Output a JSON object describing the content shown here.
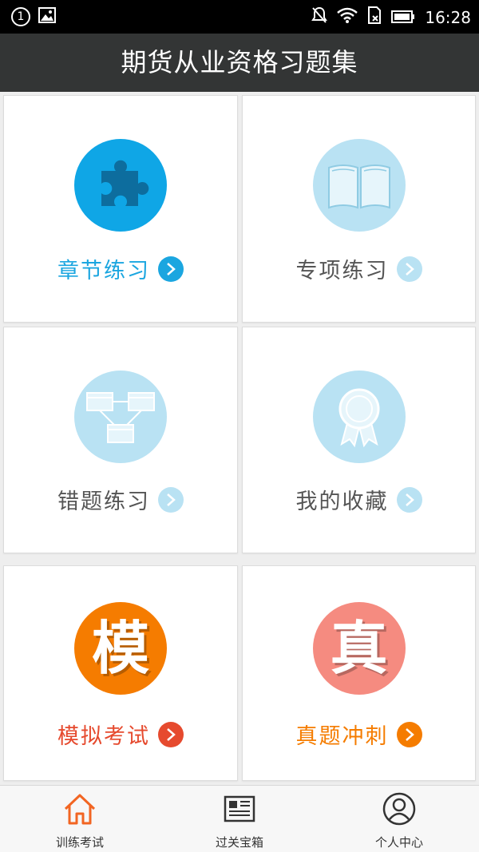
{
  "status_bar": {
    "notification_count": "1",
    "time": "16:28"
  },
  "app_bar": {
    "title": "期货从业资格习题集"
  },
  "cards": [
    {
      "label": "章节练习",
      "icon": "puzzle-icon",
      "label_color": "#1ba6e0",
      "circle_color": "#0fa6e6",
      "chevron_color": "#1ba6e0"
    },
    {
      "label": "专项练习",
      "icon": "book-icon",
      "label_color": "#555555",
      "circle_color": "#b9e2f3",
      "chevron_color": "#b9e2f3"
    },
    {
      "label": "错题练习",
      "icon": "flowchart-icon",
      "label_color": "#555555",
      "circle_color": "#b9e2f3",
      "chevron_color": "#b9e2f3"
    },
    {
      "label": "我的收藏",
      "icon": "award-ribbon-icon",
      "label_color": "#555555",
      "circle_color": "#b9e2f3",
      "chevron_color": "#b9e2f3"
    },
    {
      "label": "模拟考试",
      "icon": "mo-character-icon",
      "glyph": "模",
      "label_color": "#e64a2e",
      "circle_color": "#f57c00",
      "chevron_color": "#e64a2e"
    },
    {
      "label": "真题冲刺",
      "icon": "zhen-character-icon",
      "glyph": "真",
      "label_color": "#f57c00",
      "circle_color": "#f58b80",
      "chevron_color": "#f57c00"
    }
  ],
  "tabs": [
    {
      "label": "训练考试",
      "icon": "home-icon",
      "active": true
    },
    {
      "label": "过关宝箱",
      "icon": "news-icon",
      "active": false
    },
    {
      "label": "个人中心",
      "icon": "user-icon",
      "active": false
    }
  ]
}
